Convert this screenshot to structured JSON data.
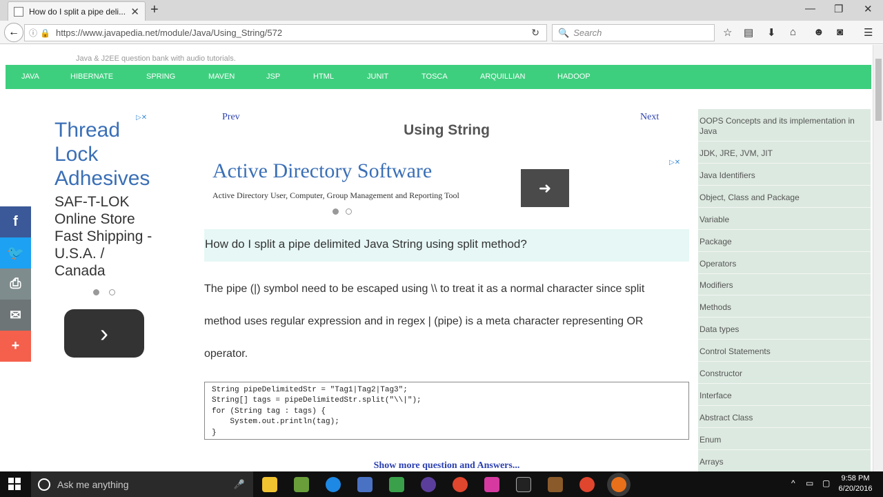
{
  "browser": {
    "tab_title": "How do I split a pipe deli...",
    "url": "https://www.javapedia.net/module/Java/Using_String/572",
    "search_placeholder": "Search"
  },
  "site": {
    "tagline": "Java & J2EE question bank with audio tutorials.",
    "nav": [
      "JAVA",
      "HIBERNATE",
      "SPRING",
      "MAVEN",
      "JSP",
      "HTML",
      "JUNIT",
      "TOSCA",
      "ARQUILLIAN",
      "HADOOP"
    ]
  },
  "left_ad": {
    "headline": [
      "Thread",
      "Lock",
      "Adhesives"
    ],
    "body": [
      "SAF-T-LOK",
      "Online Store",
      "Fast Shipping -",
      "U.S.A. /",
      "Canada"
    ]
  },
  "main": {
    "prev_label": "Prev",
    "next_label": "Next",
    "page_title": "Using String",
    "ad_title": "Active Directory Software",
    "ad_subtitle": "Active Directory User, Computer, Group Management and Reporting Tool",
    "question": "How do I split a pipe delimited Java String using split method?",
    "answer": "The pipe (|) symbol need to be escaped using \\\\ to treat it as a normal character since split method uses regular expression and in regex | (pipe) is a meta character representing OR operator.",
    "code": "String pipeDelimitedStr = \"Tag1|Tag2|Tag3\";\nString[] tags = pipeDelimitedStr.split(\"\\\\|\");\nfor (String tag : tags) {\n    System.out.println(tag);\n}",
    "show_more": "Show more question and Answers..."
  },
  "sidebar": {
    "items": [
      "OOPS Concepts and its implementation in Java",
      "JDK, JRE, JVM, JIT",
      "Java Identifiers",
      "Object, Class and Package",
      "Variable",
      "Package",
      "Operators",
      "Modifiers",
      "Methods",
      "Data types",
      "Control Statements",
      "Constructor",
      "Interface",
      "Abstract Class",
      "Enum",
      "Arrays"
    ]
  },
  "taskbar": {
    "search_placeholder": "Ask me anything",
    "time": "9:58 PM",
    "date": "6/20/2016"
  },
  "colors": {
    "nav_green": "#3ecf7e",
    "link_blue": "#2a3fb0",
    "ad_blue": "#3a6fb6",
    "sidebar_bg": "#dce9e0",
    "question_bg": "#e6f7f5"
  }
}
